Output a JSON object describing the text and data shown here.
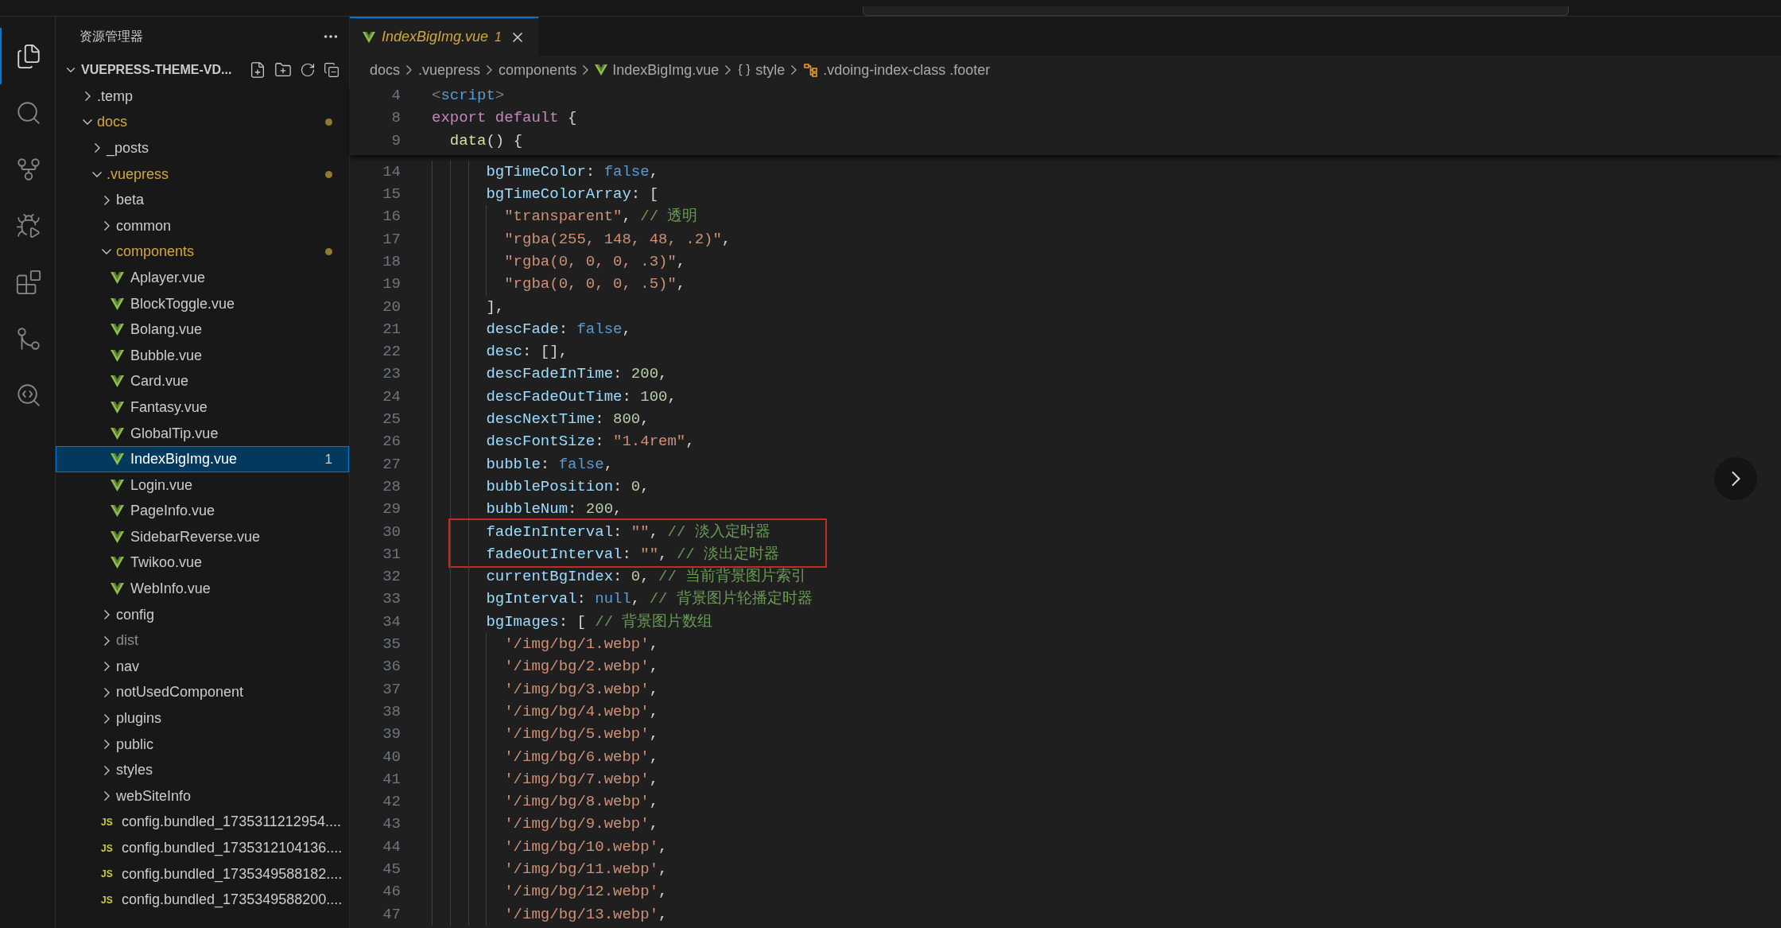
{
  "activity_bar": [
    {
      "kind": "explorer",
      "selected": true
    },
    {
      "kind": "search",
      "selected": false
    },
    {
      "kind": "source-control",
      "selected": false
    },
    {
      "kind": "run",
      "selected": false
    },
    {
      "kind": "extensions",
      "selected": false
    },
    {
      "kind": "git-graph",
      "selected": false
    },
    {
      "kind": "git-inspect",
      "selected": false
    }
  ],
  "sidebar": {
    "title": "资源管理器",
    "project": "VUEPRESS-THEME-VD...",
    "tree": [
      {
        "kind": "folder",
        "label": ".temp",
        "expanded": false,
        "modified": false,
        "ignored": false,
        "selected": false
      },
      {
        "kind": "folder",
        "label": "docs",
        "expanded": true,
        "modified": true,
        "ignored": false,
        "selected": false,
        "children": [
          {
            "kind": "folder",
            "label": "_posts",
            "expanded": false,
            "modified": false,
            "ignored": false,
            "selected": false
          },
          {
            "kind": "folder",
            "label": ".vuepress",
            "expanded": true,
            "modified": true,
            "ignored": false,
            "selected": false,
            "children": [
              {
                "kind": "folder",
                "label": "beta",
                "expanded": false,
                "modified": false,
                "ignored": false,
                "selected": false
              },
              {
                "kind": "folder",
                "label": "common",
                "expanded": false,
                "modified": false,
                "ignored": false,
                "selected": false
              },
              {
                "kind": "folder",
                "label": "components",
                "expanded": true,
                "modified": true,
                "ignored": false,
                "selected": false,
                "children": [
                  {
                    "kind": "vue",
                    "label": "Aplayer.vue",
                    "selected": false
                  },
                  {
                    "kind": "vue",
                    "label": "BlockToggle.vue",
                    "selected": false
                  },
                  {
                    "kind": "vue",
                    "label": "Bolang.vue",
                    "selected": false
                  },
                  {
                    "kind": "vue",
                    "label": "Bubble.vue",
                    "selected": false
                  },
                  {
                    "kind": "vue",
                    "label": "Card.vue",
                    "selected": false
                  },
                  {
                    "kind": "vue",
                    "label": "Fantasy.vue",
                    "selected": false
                  },
                  {
                    "kind": "vue",
                    "label": "GlobalTip.vue",
                    "selected": false
                  },
                  {
                    "kind": "vue",
                    "label": "IndexBigImg.vue",
                    "selected": true,
                    "problems": "1"
                  },
                  {
                    "kind": "vue",
                    "label": "Login.vue",
                    "selected": false
                  },
                  {
                    "kind": "vue",
                    "label": "PageInfo.vue",
                    "selected": false
                  },
                  {
                    "kind": "vue",
                    "label": "SidebarReverse.vue",
                    "selected": false
                  },
                  {
                    "kind": "vue",
                    "label": "Twikoo.vue",
                    "selected": false
                  },
                  {
                    "kind": "vue",
                    "label": "WebInfo.vue",
                    "selected": false
                  }
                ]
              },
              {
                "kind": "folder",
                "label": "config",
                "expanded": false,
                "modified": false,
                "ignored": false,
                "selected": false
              },
              {
                "kind": "folder",
                "label": "dist",
                "expanded": false,
                "modified": false,
                "ignored": true,
                "selected": false
              },
              {
                "kind": "folder",
                "label": "nav",
                "expanded": false,
                "modified": false,
                "ignored": false,
                "selected": false
              },
              {
                "kind": "folder",
                "label": "notUsedComponent",
                "expanded": false,
                "modified": false,
                "ignored": false,
                "selected": false
              },
              {
                "kind": "folder",
                "label": "plugins",
                "expanded": false,
                "modified": false,
                "ignored": false,
                "selected": false
              },
              {
                "kind": "folder",
                "label": "public",
                "expanded": false,
                "modified": false,
                "ignored": false,
                "selected": false
              },
              {
                "kind": "folder",
                "label": "styles",
                "expanded": false,
                "modified": false,
                "ignored": false,
                "selected": false
              },
              {
                "kind": "folder",
                "label": "webSiteInfo",
                "expanded": false,
                "modified": false,
                "ignored": false,
                "selected": false
              },
              {
                "kind": "js",
                "icon": "JS",
                "label": "config.bundled_1735311212954....",
                "selected": false
              },
              {
                "kind": "js",
                "icon": "JS",
                "label": "config.bundled_1735312104136....",
                "selected": false
              },
              {
                "kind": "js",
                "icon": "JS",
                "label": "config.bundled_1735349588182....",
                "selected": false
              },
              {
                "kind": "js",
                "icon": "JS",
                "label": "config.bundled_1735349588200....",
                "selected": false
              }
            ]
          }
        ]
      }
    ]
  },
  "tabs": [
    {
      "label": "IndexBigImg.vue",
      "problems": "1",
      "preview": true,
      "selected": true
    }
  ],
  "breadcrumb": [
    {
      "kind": "folder",
      "label": "docs"
    },
    {
      "kind": "folder",
      "label": ".vuepress"
    },
    {
      "kind": "folder",
      "label": "components"
    },
    {
      "kind": "vue",
      "label": "IndexBigImg.vue"
    },
    {
      "kind": "braces",
      "label": "style"
    },
    {
      "kind": "class",
      "label": ".vdoing-index-class .footer"
    }
  ],
  "sticky_lines": [
    {
      "number": "4",
      "tokens": [
        {
          "kind": "tagp",
          "text": "<"
        },
        {
          "kind": "tag",
          "text": "script"
        },
        {
          "kind": "tagp",
          "text": ">"
        }
      ]
    },
    {
      "number": "8",
      "tokens": [
        {
          "kind": "kw",
          "text": "export"
        },
        {
          "kind": "kw",
          "text": " default"
        },
        {
          "kind": "p",
          "text": " {"
        }
      ]
    },
    {
      "number": "9",
      "tokens": [
        {
          "kind": "fn",
          "text": "  data"
        },
        {
          "kind": "p",
          "text": "() {"
        }
      ]
    }
  ],
  "code_lines": [
    {
      "number": "14",
      "boxed": false,
      "tokens": [
        {
          "kind": "key",
          "text": "      bgTimeColor"
        },
        {
          "kind": "p",
          "text": ": "
        },
        {
          "kind": "bool",
          "text": "false"
        },
        {
          "kind": "p",
          "text": ","
        }
      ]
    },
    {
      "number": "15",
      "boxed": false,
      "tokens": [
        {
          "kind": "key",
          "text": "      bgTimeColorArray"
        },
        {
          "kind": "p",
          "text": ": ["
        }
      ]
    },
    {
      "number": "16",
      "boxed": false,
      "tokens": [
        {
          "kind": "str",
          "text": "        \"transparent\""
        },
        {
          "kind": "p",
          "text": ", "
        },
        {
          "kind": "cmt",
          "text": "// 透明"
        }
      ]
    },
    {
      "number": "17",
      "boxed": false,
      "tokens": [
        {
          "kind": "str",
          "text": "        \"rgba(255, 148, 48, .2)\""
        },
        {
          "kind": "p",
          "text": ","
        }
      ]
    },
    {
      "number": "18",
      "boxed": false,
      "tokens": [
        {
          "kind": "str",
          "text": "        \"rgba(0, 0, 0, .3)\""
        },
        {
          "kind": "p",
          "text": ","
        }
      ]
    },
    {
      "number": "19",
      "boxed": false,
      "tokens": [
        {
          "kind": "str",
          "text": "        \"rgba(0, 0, 0, .5)\""
        },
        {
          "kind": "p",
          "text": ","
        }
      ]
    },
    {
      "number": "20",
      "boxed": false,
      "tokens": [
        {
          "kind": "p",
          "text": "      ],"
        }
      ]
    },
    {
      "number": "21",
      "boxed": false,
      "tokens": [
        {
          "kind": "key",
          "text": "      descFade"
        },
        {
          "kind": "p",
          "text": ": "
        },
        {
          "kind": "bool",
          "text": "false"
        },
        {
          "kind": "p",
          "text": ","
        }
      ]
    },
    {
      "number": "22",
      "boxed": false,
      "tokens": [
        {
          "kind": "key",
          "text": "      desc"
        },
        {
          "kind": "p",
          "text": ": [],"
        }
      ]
    },
    {
      "number": "23",
      "boxed": false,
      "tokens": [
        {
          "kind": "key",
          "text": "      descFadeInTime"
        },
        {
          "kind": "p",
          "text": ": "
        },
        {
          "kind": "num",
          "text": "200"
        },
        {
          "kind": "p",
          "text": ","
        }
      ]
    },
    {
      "number": "24",
      "boxed": false,
      "tokens": [
        {
          "kind": "key",
          "text": "      descFadeOutTime"
        },
        {
          "kind": "p",
          "text": ": "
        },
        {
          "kind": "num",
          "text": "100"
        },
        {
          "kind": "p",
          "text": ","
        }
      ]
    },
    {
      "number": "25",
      "boxed": false,
      "tokens": [
        {
          "kind": "key",
          "text": "      descNextTime"
        },
        {
          "kind": "p",
          "text": ": "
        },
        {
          "kind": "num",
          "text": "800"
        },
        {
          "kind": "p",
          "text": ","
        }
      ]
    },
    {
      "number": "26",
      "boxed": false,
      "tokens": [
        {
          "kind": "key",
          "text": "      descFontSize"
        },
        {
          "kind": "p",
          "text": ": "
        },
        {
          "kind": "str",
          "text": "\"1.4rem\""
        },
        {
          "kind": "p",
          "text": ","
        }
      ]
    },
    {
      "number": "27",
      "boxed": false,
      "tokens": [
        {
          "kind": "key",
          "text": "      bubble"
        },
        {
          "kind": "p",
          "text": ": "
        },
        {
          "kind": "bool",
          "text": "false"
        },
        {
          "kind": "p",
          "text": ","
        }
      ]
    },
    {
      "number": "28",
      "boxed": false,
      "tokens": [
        {
          "kind": "key",
          "text": "      bubblePosition"
        },
        {
          "kind": "p",
          "text": ": "
        },
        {
          "kind": "num",
          "text": "0"
        },
        {
          "kind": "p",
          "text": ","
        }
      ]
    },
    {
      "number": "29",
      "boxed": false,
      "tokens": [
        {
          "kind": "key",
          "text": "      bubbleNum"
        },
        {
          "kind": "p",
          "text": ": "
        },
        {
          "kind": "num",
          "text": "200"
        },
        {
          "kind": "p",
          "text": ","
        }
      ]
    },
    {
      "number": "30",
      "boxed": true,
      "tokens": [
        {
          "kind": "key",
          "text": "      fadeInInterval"
        },
        {
          "kind": "p",
          "text": ": "
        },
        {
          "kind": "str",
          "text": "\"\""
        },
        {
          "kind": "p",
          "text": ", "
        },
        {
          "kind": "cmt",
          "text": "// 淡入定时器"
        }
      ]
    },
    {
      "number": "31",
      "boxed": true,
      "tokens": [
        {
          "kind": "key",
          "text": "      fadeOutInterval"
        },
        {
          "kind": "p",
          "text": ": "
        },
        {
          "kind": "str",
          "text": "\"\""
        },
        {
          "kind": "p",
          "text": ", "
        },
        {
          "kind": "cmt",
          "text": "// 淡出定时器"
        }
      ]
    },
    {
      "number": "32",
      "boxed": false,
      "tokens": [
        {
          "kind": "key",
          "text": "      currentBgIndex"
        },
        {
          "kind": "p",
          "text": ": "
        },
        {
          "kind": "num",
          "text": "0"
        },
        {
          "kind": "p",
          "text": ", "
        },
        {
          "kind": "cmt",
          "text": "// 当前背景图片索引"
        }
      ]
    },
    {
      "number": "33",
      "boxed": false,
      "tokens": [
        {
          "kind": "key",
          "text": "      bgInterval"
        },
        {
          "kind": "p",
          "text": ": "
        },
        {
          "kind": "bool",
          "text": "null"
        },
        {
          "kind": "p",
          "text": ", "
        },
        {
          "kind": "cmt",
          "text": "// 背景图片轮播定时器"
        }
      ]
    },
    {
      "number": "34",
      "boxed": false,
      "tokens": [
        {
          "kind": "key",
          "text": "      bgImages"
        },
        {
          "kind": "p",
          "text": ": [ "
        },
        {
          "kind": "cmt",
          "text": "// 背景图片数组"
        }
      ]
    },
    {
      "number": "35",
      "boxed": false,
      "tokens": [
        {
          "kind": "str",
          "text": "        '/img/bg/1.webp'"
        },
        {
          "kind": "p",
          "text": ","
        }
      ]
    },
    {
      "number": "36",
      "boxed": false,
      "tokens": [
        {
          "kind": "str",
          "text": "        '/img/bg/2.webp'"
        },
        {
          "kind": "p",
          "text": ","
        }
      ]
    },
    {
      "number": "37",
      "boxed": false,
      "tokens": [
        {
          "kind": "str",
          "text": "        '/img/bg/3.webp'"
        },
        {
          "kind": "p",
          "text": ","
        }
      ]
    },
    {
      "number": "38",
      "boxed": false,
      "tokens": [
        {
          "kind": "str",
          "text": "        '/img/bg/4.webp'"
        },
        {
          "kind": "p",
          "text": ","
        }
      ]
    },
    {
      "number": "39",
      "boxed": false,
      "tokens": [
        {
          "kind": "str",
          "text": "        '/img/bg/5.webp'"
        },
        {
          "kind": "p",
          "text": ","
        }
      ]
    },
    {
      "number": "40",
      "boxed": false,
      "tokens": [
        {
          "kind": "str",
          "text": "        '/img/bg/6.webp'"
        },
        {
          "kind": "p",
          "text": ","
        }
      ]
    },
    {
      "number": "41",
      "boxed": false,
      "tokens": [
        {
          "kind": "str",
          "text": "        '/img/bg/7.webp'"
        },
        {
          "kind": "p",
          "text": ","
        }
      ]
    },
    {
      "number": "42",
      "boxed": false,
      "tokens": [
        {
          "kind": "str",
          "text": "        '/img/bg/8.webp'"
        },
        {
          "kind": "p",
          "text": ","
        }
      ]
    },
    {
      "number": "43",
      "boxed": false,
      "tokens": [
        {
          "kind": "str",
          "text": "        '/img/bg/9.webp'"
        },
        {
          "kind": "p",
          "text": ","
        }
      ]
    },
    {
      "number": "44",
      "boxed": false,
      "tokens": [
        {
          "kind": "str",
          "text": "        '/img/bg/10.webp'"
        },
        {
          "kind": "p",
          "text": ","
        }
      ]
    },
    {
      "number": "45",
      "boxed": false,
      "tokens": [
        {
          "kind": "str",
          "text": "        '/img/bg/11.webp'"
        },
        {
          "kind": "p",
          "text": ","
        }
      ]
    },
    {
      "number": "46",
      "boxed": false,
      "tokens": [
        {
          "kind": "str",
          "text": "        '/img/bg/12.webp'"
        },
        {
          "kind": "p",
          "text": ","
        }
      ]
    },
    {
      "number": "47",
      "boxed": false,
      "tokens": [
        {
          "kind": "str",
          "text": "        '/img/bg/13.webp'"
        },
        {
          "kind": "p",
          "text": ","
        }
      ]
    }
  ]
}
